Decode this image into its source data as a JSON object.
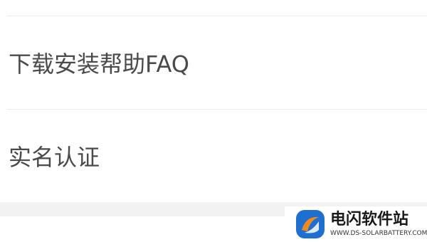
{
  "menu": {
    "items": [
      {
        "label": "下载安装帮助FAQ"
      },
      {
        "label": "实名认证"
      }
    ]
  },
  "watermark": {
    "title": "电闪软件站",
    "url": "WWW.DS-SOLARBATTERY.COM",
    "colors": {
      "blue": "#1f6fd1",
      "orange": "#f08a1c"
    }
  }
}
